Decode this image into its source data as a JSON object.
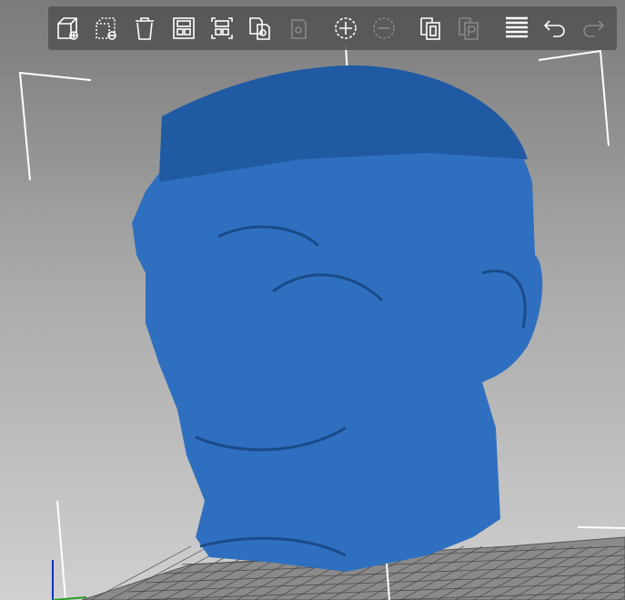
{
  "toolbar": {
    "buttons": [
      {
        "name": "add",
        "icon": "add-object-icon",
        "enabled": true
      },
      {
        "name": "delete",
        "icon": "delete-object-icon",
        "enabled": true
      },
      {
        "name": "delete-all",
        "icon": "trash-icon",
        "enabled": true
      },
      {
        "name": "arrange",
        "icon": "arrange-icon",
        "enabled": true
      },
      {
        "name": "arrange-selection",
        "icon": "arrange-selection-icon",
        "enabled": true
      },
      {
        "name": "copy",
        "icon": "copy-icon",
        "enabled": true
      },
      {
        "name": "paste",
        "icon": "paste-icon",
        "enabled": false
      },
      {
        "name": "add-instance",
        "icon": "add-instance-icon",
        "enabled": true
      },
      {
        "name": "remove-instance",
        "icon": "remove-instance-icon",
        "enabled": false
      },
      {
        "name": "split-objects",
        "icon": "split-objects-icon",
        "enabled": true
      },
      {
        "name": "split-parts",
        "icon": "split-parts-icon",
        "enabled": false
      },
      {
        "name": "layers",
        "icon": "layers-editing-icon",
        "enabled": true
      },
      {
        "name": "undo",
        "icon": "undo-icon",
        "enabled": true
      },
      {
        "name": "redo",
        "icon": "redo-icon",
        "enabled": false
      }
    ]
  },
  "colors": {
    "model": "#2f6fc0",
    "model_top": "#1f5aa3",
    "bed": "#6a6a6a"
  }
}
